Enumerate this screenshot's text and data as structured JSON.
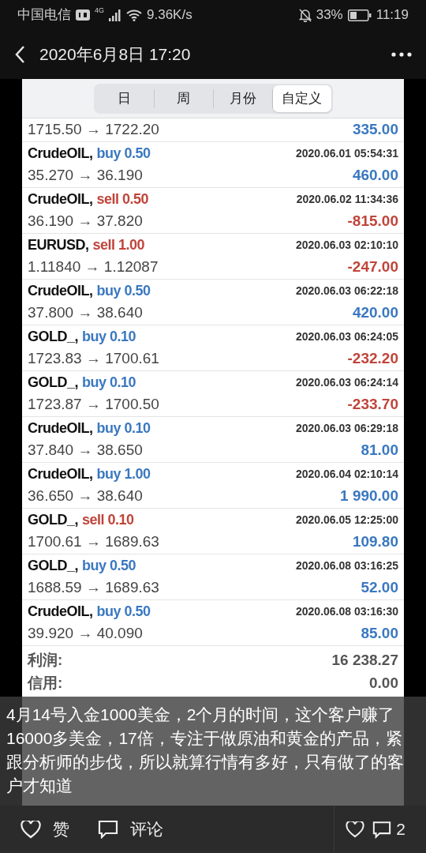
{
  "status_bar": {
    "carrier": "中国电信",
    "network": "4G",
    "speed": "9.36K/s",
    "battery": "33%",
    "time": "11:19"
  },
  "header": {
    "title": "2020年6月8日 17:20"
  },
  "tabs": [
    {
      "label": "日",
      "selected": false
    },
    {
      "label": "周",
      "selected": false
    },
    {
      "label": "月份",
      "selected": false
    },
    {
      "label": "自定义",
      "selected": true
    }
  ],
  "first_row": {
    "prices": "1715.50 → 1722.20",
    "profit": "335.00",
    "loss": false
  },
  "trades": [
    {
      "symbol": "CrudeOIL,",
      "side": "buy",
      "volume": "0.50",
      "time": "2020.06.01 05:54:31",
      "prices": "35.270 → 36.190",
      "profit": "460.00",
      "loss": false
    },
    {
      "symbol": "CrudeOIL,",
      "side": "sell",
      "volume": "0.50",
      "time": "2020.06.02 11:34:36",
      "prices": "36.190 → 37.820",
      "profit": "-815.00",
      "loss": true
    },
    {
      "symbol": "EURUSD,",
      "side": "sell",
      "volume": "1.00",
      "time": "2020.06.03 02:10:10",
      "prices": "1.11840 → 1.12087",
      "profit": "-247.00",
      "loss": true
    },
    {
      "symbol": "CrudeOIL,",
      "side": "buy",
      "volume": "0.50",
      "time": "2020.06.03 06:22:18",
      "prices": "37.800 → 38.640",
      "profit": "420.00",
      "loss": false
    },
    {
      "symbol": "GOLD_,",
      "side": "buy",
      "volume": "0.10",
      "time": "2020.06.03 06:24:05",
      "prices": "1723.83 → 1700.61",
      "profit": "-232.20",
      "loss": true
    },
    {
      "symbol": "GOLD_,",
      "side": "buy",
      "volume": "0.10",
      "time": "2020.06.03 06:24:14",
      "prices": "1723.87 → 1700.50",
      "profit": "-233.70",
      "loss": true
    },
    {
      "symbol": "CrudeOIL,",
      "side": "buy",
      "volume": "0.10",
      "time": "2020.06.03 06:29:18",
      "prices": "37.840 → 38.650",
      "profit": "81.00",
      "loss": false
    },
    {
      "symbol": "CrudeOIL,",
      "side": "buy",
      "volume": "1.00",
      "time": "2020.06.04 02:10:14",
      "prices": "36.650 → 38.640",
      "profit": "1 990.00",
      "loss": false
    },
    {
      "symbol": "GOLD_,",
      "side": "sell",
      "volume": "0.10",
      "time": "2020.06.05 12:25:00",
      "prices": "1700.61 → 1689.63",
      "profit": "109.80",
      "loss": false
    },
    {
      "symbol": "GOLD_,",
      "side": "buy",
      "volume": "0.50",
      "time": "2020.06.08 03:16:25",
      "prices": "1688.59 → 1689.63",
      "profit": "52.00",
      "loss": false
    },
    {
      "symbol": "CrudeOIL,",
      "side": "buy",
      "volume": "0.50",
      "time": "2020.06.08 03:16:30",
      "prices": "39.920 → 40.090",
      "profit": "85.00",
      "loss": false
    }
  ],
  "summary": [
    {
      "label": "利润:",
      "value": "16 238.27"
    },
    {
      "label": "信用:",
      "value": "0.00"
    }
  ],
  "caption": "4月14号入金1000美金，2个月的时间，这个客户赚了16000多美金，17倍，专注于做原油和黄金的产品，紧跟分析师的步伐，所以就算行情有多好，只有做了的客户才知道",
  "actions": {
    "like": "赞",
    "comment": "评论",
    "comment_count": "2"
  }
}
